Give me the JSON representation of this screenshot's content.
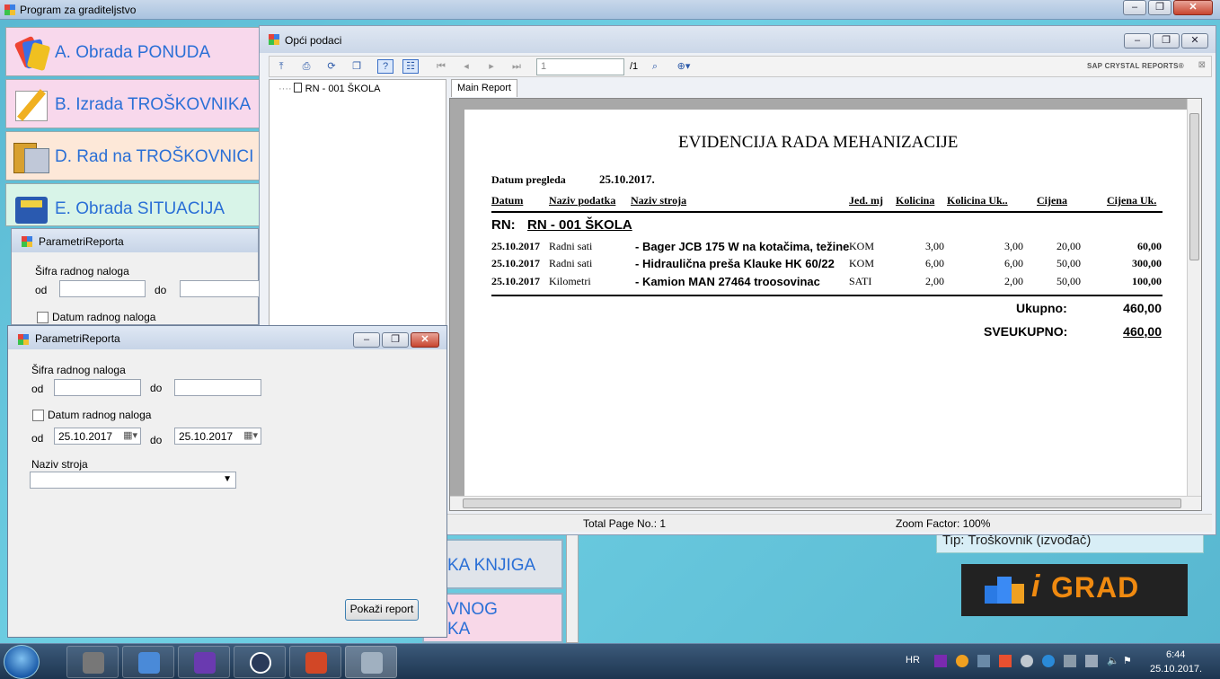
{
  "main_window": {
    "title": "Program za graditeljstvo"
  },
  "menu": [
    {
      "label": "A. Obrada PONUDA",
      "bg": "#f8d8ec"
    },
    {
      "label": "B. Izrada TROŠKOVNIKA",
      "bg": "#f8d8ec"
    },
    {
      "label": "D. Rad na TROŠKOVNICI",
      "bg": "#fde8d8"
    },
    {
      "label": "E. Obrada SITUACIJA",
      "bg": "#d8f4e8"
    }
  ],
  "lower_tiles": {
    "tile1": "KA KNJIGA",
    "tile2a": "VNOG",
    "tile2b": "KA",
    "info_text": "Tip: Troškovnik (izvođač)"
  },
  "logo": {
    "i": "i",
    "text": "GRAD"
  },
  "crystal": {
    "title": "Opći podaci",
    "page_input": "1",
    "page_total": "/1",
    "brand": "SAP CRYSTAL REPORTS®",
    "tree_node": "RN - 001 ŠKOLA",
    "tab": "Main Report",
    "status_total": "Total Page No.: 1",
    "status_zoom": "Zoom Factor: 100%"
  },
  "report": {
    "title": "EVIDENCIJA RADA MEHANIZACIJE",
    "date_label": "Datum pregleda",
    "date_value": "25.10.2017.",
    "columns": {
      "datum": "Datum",
      "naziv_podatka": "Naziv podatka",
      "naziv_stroja": "Naziv stroja",
      "jed_mj": "Jed. mj",
      "kolicina": "Kolicina",
      "kolicina_uk": "Kolicina Uk..",
      "cijena": "Cijena",
      "cijena_uk": "Cijena Uk."
    },
    "rn_label": "RN:",
    "rn_value": "RN - 001 ŠKOLA",
    "rows": [
      {
        "datum": "25.10.2017",
        "podatak": "Radni sati",
        "stroj": "- Bager JCB 175 W na kotačima, težine",
        "jm": "KOM",
        "kol": "3,00",
        "kol_uk": "3,00",
        "cijena": "20,00",
        "cijena_uk": "60,00"
      },
      {
        "datum": "25.10.2017",
        "podatak": "Radni sati",
        "stroj": "- Hidraulična preša Klauke HK 60/22",
        "jm": "KOM",
        "kol": "6,00",
        "kol_uk": "6,00",
        "cijena": "50,00",
        "cijena_uk": "300,00"
      },
      {
        "datum": "25.10.2017",
        "podatak": "Kilometri",
        "stroj": "- Kamion MAN 27464 troosovinac",
        "jm": "SATI",
        "kol": "2,00",
        "kol_uk": "2,00",
        "cijena": "50,00",
        "cijena_uk": "100,00"
      }
    ],
    "ukupno_label": "Ukupno:",
    "ukupno_value": "460,00",
    "sveukupno_label": "SVEUKUPNO:",
    "sveukupno_value": "460,00"
  },
  "param_back": {
    "title": "ParametriReporta",
    "sifra_label": "Šifra radnog naloga",
    "od": "od",
    "do": "do",
    "datum_label": "Datum radnog naloga"
  },
  "param_front": {
    "title": "ParametriReporta",
    "sifra_label": "Šifra radnog naloga",
    "od": "od",
    "do": "do",
    "datum_label": "Datum radnog naloga",
    "date_from": "25.10.2017",
    "date_to": "25.10.2017",
    "naziv_label": "Naziv stroja",
    "button": "Pokaži report"
  },
  "taskbar": {
    "lang": "HR",
    "time": "6:44",
    "date": "25.10.2017."
  }
}
